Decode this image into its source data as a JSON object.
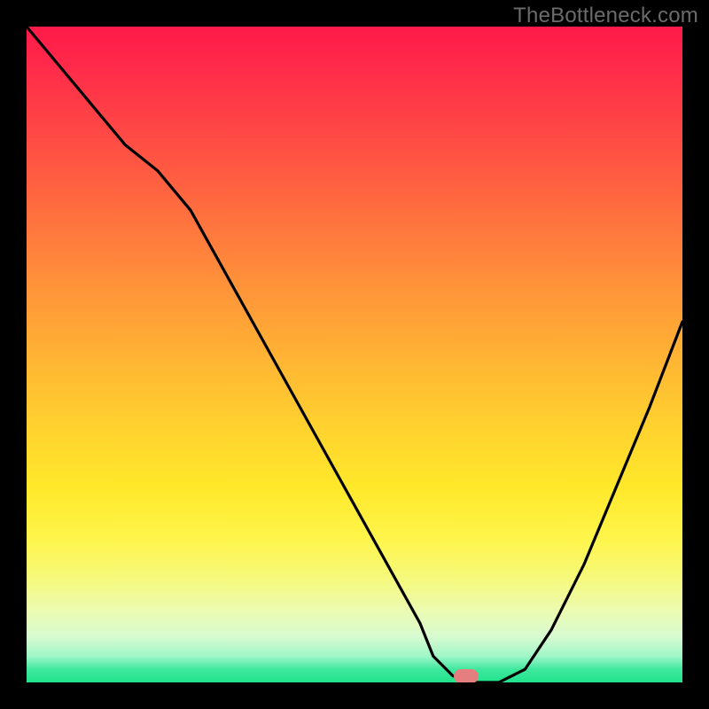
{
  "watermark": "TheBottleneck.com",
  "colors": {
    "frame_bg": "#000000",
    "curve": "#000000",
    "marker": "#e57e7f",
    "gradient_top": "#ff1a4a",
    "gradient_bottom": "#1fe38c"
  },
  "chart_data": {
    "type": "line",
    "title": "",
    "xlabel": "",
    "ylabel": "",
    "xlim": [
      0,
      100
    ],
    "ylim": [
      0,
      100
    ],
    "grid": false,
    "legend": false,
    "x": [
      0,
      5,
      10,
      15,
      20,
      25,
      30,
      35,
      40,
      45,
      50,
      55,
      60,
      62,
      65,
      68,
      72,
      76,
      80,
      85,
      90,
      95,
      100
    ],
    "values": [
      100,
      94,
      88,
      82,
      78,
      72,
      63,
      54,
      45,
      36,
      27,
      18,
      9,
      4,
      1,
      0,
      0,
      2,
      8,
      18,
      30,
      42,
      55
    ],
    "marker": {
      "x": 67,
      "y": 1
    },
    "notes": "Bottleneck-style V-curve. X axis proportional (no ticks shown). Y inverted visually: 0 = bottom (green/good), 100 = top (red/bad). Flat minimum near x≈65–72."
  }
}
